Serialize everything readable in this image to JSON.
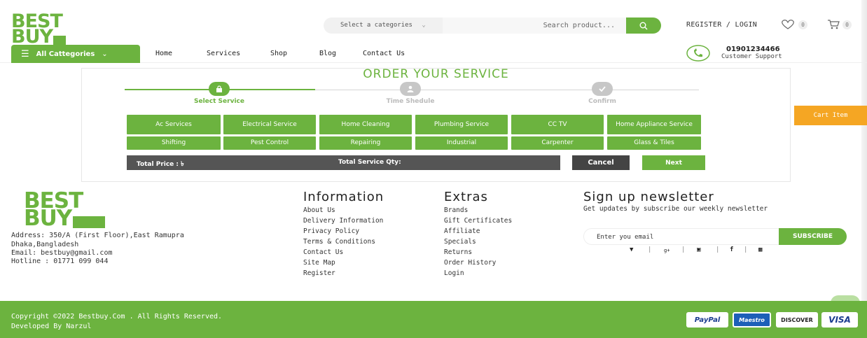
{
  "logo": {
    "line1": "BEST",
    "line2": "BUY"
  },
  "header": {
    "category_select": "Select a categories",
    "search_placeholder": "Search product...",
    "register_login": "REGISTER / LOGIN",
    "wishlist_count": "0",
    "cart_count": "0"
  },
  "nav": {
    "all_categories": "All Cattegories",
    "links": [
      "Home",
      "Services",
      "Shop",
      "Blog",
      "Contact Us"
    ],
    "phone": "01901234466",
    "support": "Customer Support"
  },
  "order": {
    "title": "ORDER YOUR SERVICE",
    "steps": [
      "Select Service",
      "Time Shedule",
      "Confirm"
    ],
    "services_row1": [
      "Ac Services",
      "Electrical Service",
      "Home Cleaning",
      "Plumbing Service",
      "CC TV",
      "Home Appliance Service"
    ],
    "services_row2": [
      "Shifting",
      "Pest Control",
      "Repairing",
      "Industrial",
      "Carpenter",
      "Glass & Tiles"
    ],
    "total_price": "Total Price : ৳",
    "total_qty": "Total Service Qty:",
    "cancel": "Cancel",
    "next": "Next"
  },
  "cart_tab": "Cart Item",
  "footer": {
    "address": [
      "Address: 350/A (First Floor),East Ramupra",
      "Dhaka,Bangladesh",
      "Email: bestbuy@gmail.com",
      "Hotline : 01771 099 044"
    ],
    "information": {
      "title": "Information",
      "links": [
        "About Us",
        "Delivery Information",
        "Privacy Policy",
        "Terms & Conditions",
        "Contact Us",
        "Site Map",
        "Register"
      ]
    },
    "extras": {
      "title": "Extras",
      "links": [
        "Brands",
        "Gift Certificates",
        "Affiliate",
        "Specials",
        "Returns",
        "Order History",
        "Login"
      ]
    },
    "newsletter": {
      "title": "Sign up newsletter",
      "description": "Get updates by subscribe our weekly newsletter",
      "placeholder": "Enter you email",
      "button": "SUBSCRIBE"
    },
    "copyright": "Copyright ©2022 Bestbuy.Com . All Rights Reserved.",
    "developed": "Developed By Narzul",
    "payments": [
      "PayPal",
      "Maestro",
      "DISCOVER",
      "VISA"
    ]
  },
  "colors": {
    "brand_green": "#6cb33f",
    "cart_orange": "#f5a623",
    "dark_bar": "#555555"
  }
}
